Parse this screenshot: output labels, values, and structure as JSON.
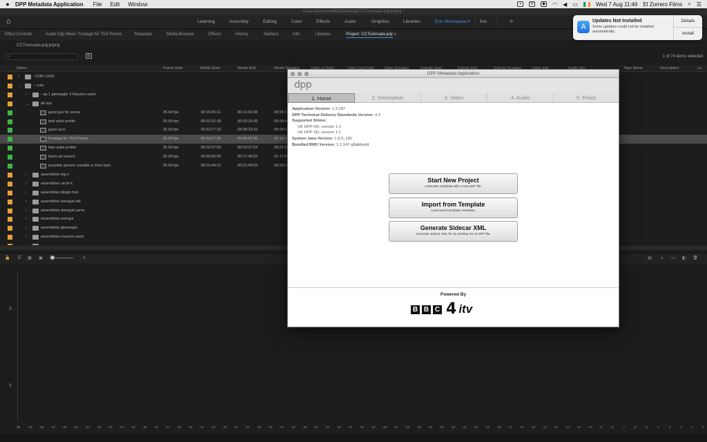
{
  "menubar": {
    "app_name": "DPP Metadata Application",
    "menus": [
      "File",
      "Edit",
      "Window"
    ],
    "datetime": "Wed 7 Aug  11:46",
    "user": "El Zorrero Films"
  },
  "premiere": {
    "path_title": "/Users/elzorrerofilms/Desktop/CCTionnuala-july.prproj *",
    "workspaces": [
      "Learning",
      "Assembly",
      "Editing",
      "Color",
      "Effects",
      "Audio",
      "Graphics",
      "Libraries",
      "Erin Workspace",
      "finn"
    ],
    "active_workspace": "Erin Workspace",
    "workspace_more": "»",
    "panel_tabs": [
      "Effect Controls",
      "Audio Clip Mixer: Footage for TG4 Promo",
      "Metadata",
      "Media Browser",
      "Effects",
      "History",
      "Markers",
      "Info",
      "Libraries",
      "Project: CCTionnuala-july"
    ],
    "project_file": "CCTionnuala-july.prproj",
    "search_placeholder": "",
    "item_count": "1 of 74 items selected",
    "columns": [
      "Name",
      "Frame Rate",
      "Media Start",
      "Media End",
      "Media Duration",
      "Video In Point",
      "Video Out Point",
      "Video Duration",
      "Subclip Start",
      "Subclip End",
      "Subclip Duration",
      "Video Info",
      "Audio Info",
      "Tape Name",
      "Description",
      "Lo"
    ],
    "rows": [
      {
        "name": "- FOR LUKE",
        "color": "#e8a03a",
        "kind": "folder",
        "indent": 0,
        "twist": ">",
        "fps": "",
        "start": "",
        "end": "",
        "dur": ""
      },
      {
        "name": "-- cuts",
        "color": "#e8a03a",
        "kind": "folder",
        "indent": 0,
        "twist": "v",
        "fps": "",
        "start": "",
        "end": "",
        "dur": ""
      },
      {
        "name": "- ep 1 gleneagle V Maurice ward",
        "color": "#e8a03a",
        "kind": "folder",
        "indent": 1,
        "twist": ">",
        "fps": "",
        "start": "",
        "end": "",
        "dur": ""
      },
      {
        "name": "all eps",
        "color": "#e8a03a",
        "kind": "folder",
        "indent": 1,
        "twist": "v",
        "fps": "",
        "start": "",
        "end": "",
        "dur": ""
      },
      {
        "name": "good gvs for series",
        "color": "#3fb54a",
        "kind": "seq",
        "indent": 2,
        "twist": "",
        "fps": "25.00 fps",
        "start": "00:16:25:11",
        "end": "00:21:41:08",
        "dur": "00:05:1"
      },
      {
        "name": "brid artist profile",
        "color": "#3fb54a",
        "kind": "seq",
        "indent": 2,
        "twist": "",
        "fps": "25.00 fps",
        "start": "00:01:32:18",
        "end": "00:02:16:05",
        "dur": "00:00:4"
      },
      {
        "name": "good sync",
        "color": "#3fb54a",
        "kind": "seq",
        "indent": 2,
        "twist": "",
        "fps": "25.00 fps",
        "start": "03:32:17:15",
        "end": "03:38:23:15",
        "dur": "00:06:0"
      },
      {
        "name": "Footage for TG4 Promo",
        "color": "#3fb54a",
        "kind": "seq",
        "indent": 2,
        "twist": "",
        "fps": "25.00 fps",
        "start": "03:32:17:15",
        "end": "03:45:47:05",
        "dur": "00:13:2",
        "selected": true
      },
      {
        "name": "liam artist profile",
        "color": "#3fb54a",
        "kind": "seq",
        "indent": 2,
        "twist": "",
        "fps": "25.00 fps",
        "start": "00:02:07:20",
        "end": "00:03:37:24",
        "dur": "00:01:3"
      },
      {
        "name": "liams art launch",
        "color": "#3fb54a",
        "kind": "seq",
        "indent": 2,
        "twist": "",
        "fps": "25.00 fps",
        "start": "04:59:56:00",
        "end": "06:17:40:03",
        "dur": "01:17:4"
      },
      {
        "name": "possible generic useable iv from liam",
        "color": "#3fb54a",
        "kind": "seq",
        "indent": 2,
        "twist": "",
        "fps": "25.00 fps",
        "start": "00:16:44:12",
        "end": "00:21:49:03",
        "dur": "00:05:0"
      },
      {
        "name": "assemblies big o",
        "color": "#e8a03a",
        "kind": "folder",
        "indent": 1,
        "twist": ">",
        "fps": "",
        "start": "",
        "end": "",
        "dur": ""
      },
      {
        "name": "assemblies circle k",
        "color": "#e8a03a",
        "kind": "folder",
        "indent": 1,
        "twist": ">",
        "fps": "",
        "start": "",
        "end": "",
        "dur": ""
      },
      {
        "name": "assemblies dingle hub",
        "color": "#e8a03a",
        "kind": "folder",
        "indent": 1,
        "twist": ">",
        "fps": "",
        "start": "",
        "end": "",
        "dur": ""
      },
      {
        "name": "assemblies donegal etb",
        "color": "#e8a03a",
        "kind": "folder",
        "indent": 1,
        "twist": ">",
        "fps": "",
        "start": "",
        "end": "",
        "dur": ""
      },
      {
        "name": "assemblies donegal yarns",
        "color": "#e8a03a",
        "kind": "folder",
        "indent": 1,
        "twist": ">",
        "fps": "",
        "start": "",
        "end": "",
        "dur": ""
      },
      {
        "name": "assemblies energia",
        "color": "#e8a03a",
        "kind": "folder",
        "indent": 1,
        "twist": ">",
        "fps": "",
        "start": "",
        "end": "",
        "dur": ""
      },
      {
        "name": "assemblies gleneagle",
        "color": "#e8a03a",
        "kind": "folder",
        "indent": 1,
        "twist": ">",
        "fps": "",
        "start": "",
        "end": "",
        "dur": ""
      },
      {
        "name": "assemblies maurice ward",
        "color": "#e8a03a",
        "kind": "folder",
        "indent": 1,
        "twist": ">",
        "fps": "",
        "start": "",
        "end": "",
        "dur": ""
      },
      {
        "name": "",
        "color": "#e8a03a",
        "kind": "folder",
        "indent": 1,
        "twist": ">",
        "fps": "",
        "start": "",
        "end": "",
        "dur": ""
      }
    ],
    "meter_ticks": [
      "dB",
      "-59",
      "-58",
      "-57",
      "-56",
      "-55",
      "-54",
      "-53",
      "-52",
      "-51",
      "-50",
      "-49",
      "-48",
      "-47",
      "-46",
      "-45",
      "-44",
      "-43",
      "-42",
      "-41",
      "-40",
      "-39",
      "-38",
      "-37",
      "-36",
      "-35",
      "-34",
      "-33",
      "-32",
      "-31",
      "-30",
      "-29",
      "-28",
      "-27",
      "-26",
      "-25",
      "-24",
      "-23",
      "-22",
      "-21",
      "-20",
      "-19",
      "-18",
      "-17",
      "-16",
      "-15",
      "-14",
      "-13",
      "-12",
      "-11",
      "-10",
      "-9",
      "-8",
      "-7",
      "-6",
      "-5",
      "-4",
      "-3",
      "-2",
      "-1",
      "0"
    ],
    "side_label": "S"
  },
  "notification": {
    "title": "Updates Not Installed",
    "body": "Some updates could not be installed automatically.",
    "details_label": "Details",
    "install_label": "Install"
  },
  "dpp": {
    "window_title": "DPP Metadata Application",
    "logo_text": "dpp",
    "tabs": [
      "1. Home",
      "2. Descriptive",
      "3. Video",
      "4. Audio",
      "5. Finish"
    ],
    "active_tab": "1. Home",
    "info": {
      "app_version_label": "Application Version:",
      "app_version": "1.3.187",
      "standards_label": "DPP Technical Delivery Standards Version:",
      "standards_version": "4.3",
      "shims_label": "Supported Shims:",
      "shims": [
        "UK DPP HD, version 1.1",
        "UK DPP SD, version 1.1"
      ],
      "java_label": "System Java Version:",
      "java_version": "1.8.0_181",
      "bmx_label": "Bundled BMX Version:",
      "bmx_version": "1.2-147-g8abbedd"
    },
    "buttons": [
      {
        "title": "Start New Project",
        "subtitle": "Associate metadata with a new MXF file."
      },
      {
        "title": "Import from Template",
        "subtitle": "Load saved template metadata."
      },
      {
        "title": "Generate Sidecar XML",
        "subtitle": "Generate sidecar XML for an existing AS-11 DPP file."
      }
    ],
    "powered_by": "Powered By",
    "broadcasters": {
      "bbc": [
        "B",
        "B",
        "C"
      ],
      "c4": "4",
      "itv": "itv"
    }
  }
}
